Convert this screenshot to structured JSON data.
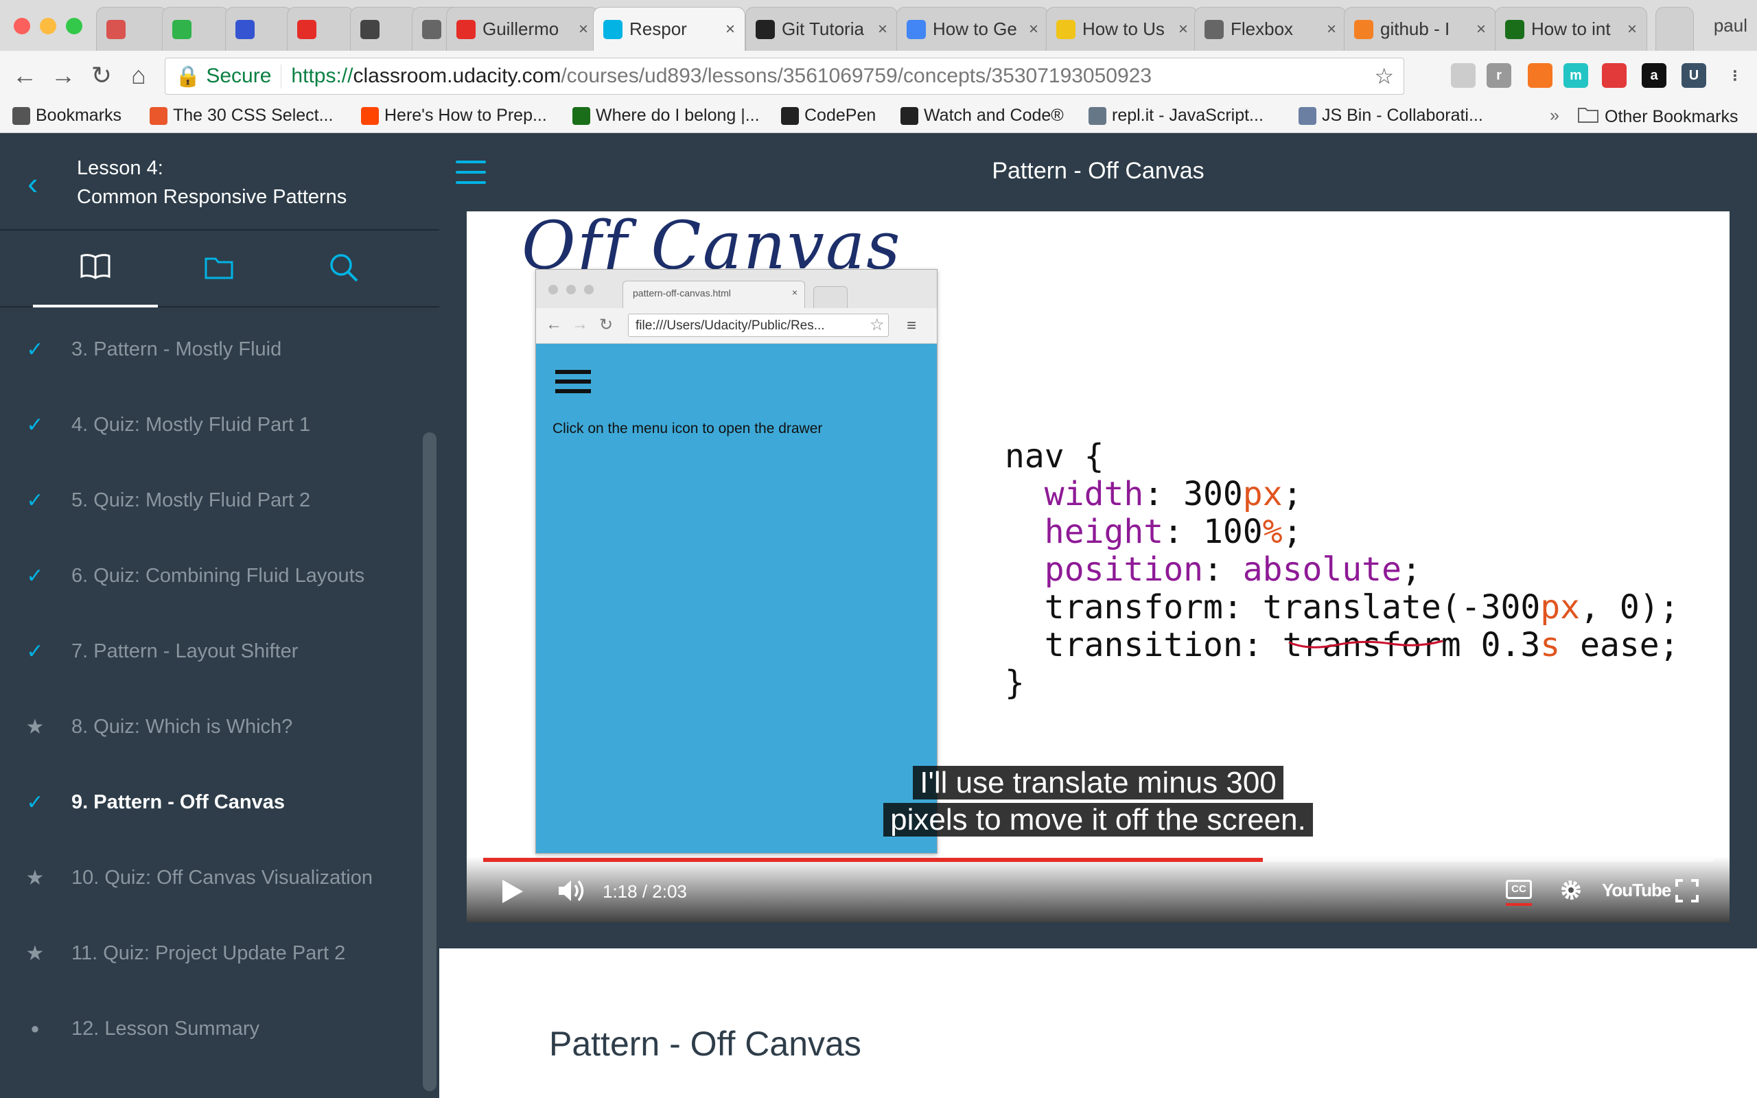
{
  "browser": {
    "tabs": [
      {
        "icon": "mushroom-icon",
        "color": "#d9534f",
        "title": ""
      },
      {
        "icon": "udacity-u-icon",
        "color": "#2fb34a",
        "title": ""
      },
      {
        "icon": "c-icon",
        "color": "#3454d1",
        "title": ""
      },
      {
        "icon": "youtube-icon",
        "color": "#e52d27",
        "title": ""
      },
      {
        "icon": "camera-icon",
        "color": "#444444",
        "title": ""
      },
      {
        "icon": "page-icon",
        "color": "#666666",
        "title": ""
      },
      {
        "icon": "youtube-icon",
        "color": "#e52d27",
        "title": "Guillermo"
      },
      {
        "icon": "udacity-icon",
        "color": "#02b3e4",
        "title": "Respor"
      },
      {
        "icon": "github-icon",
        "color": "#222222",
        "title": "Git Tutoria"
      },
      {
        "icon": "google-icon",
        "color": "#4285f4",
        "title": "How to Ge"
      },
      {
        "icon": "d-icon",
        "color": "#f0c419",
        "title": "How to Us"
      },
      {
        "icon": "page-icon",
        "color": "#666666",
        "title": "Flexbox"
      },
      {
        "icon": "stackoverflow-icon",
        "color": "#f48024",
        "title": "github - I"
      },
      {
        "icon": "codingame-icon",
        "color": "#1a6e1a",
        "title": "How to int"
      }
    ],
    "active_tab": 7,
    "profile": "paul",
    "secure_label": "Secure",
    "url_scheme": "https://",
    "url_host": "classroom.udacity.com",
    "url_path": "/courses/ud893/lessons/3561069759/concepts/35307193050923",
    "extensions": [
      {
        "icon": "cube-icon",
        "color": "#cccccc",
        "glyph": ""
      },
      {
        "icon": "r-icon",
        "color": "#999999",
        "glyph": "r"
      },
      {
        "icon": "hubspot-icon",
        "color": "#f57722",
        "glyph": ""
      },
      {
        "icon": "m-icon",
        "color": "#23c4c4",
        "glyph": "m"
      },
      {
        "icon": "tomato-icon",
        "color": "#e23a3a",
        "glyph": ""
      },
      {
        "icon": "amazon-icon",
        "color": "#111111",
        "glyph": "a"
      },
      {
        "icon": "u-icon",
        "color": "#3b5166",
        "glyph": "U"
      }
    ],
    "bookmarks": [
      {
        "label": "Bookmarks",
        "icon": "grid-icon",
        "color": "#555555"
      },
      {
        "label": "The 30 CSS Select...",
        "icon": "plus-icon",
        "color": "#e9572b"
      },
      {
        "label": "Here's How to Prep...",
        "icon": "reddit-icon",
        "color": "#ff4500"
      },
      {
        "label": "Where do I belong |...",
        "icon": "codingame-icon",
        "color": "#1a6e1a"
      },
      {
        "label": "CodePen",
        "icon": "codepen-icon",
        "color": "#222222"
      },
      {
        "label": "Watch and Code®",
        "icon": "w-icon",
        "color": "#222222"
      },
      {
        "label": "repl.it - JavaScript...",
        "icon": "replit-icon",
        "color": "#667788"
      },
      {
        "label": "JS Bin - Collaborati...",
        "icon": "jsbin-icon",
        "color": "#6b7fa3"
      }
    ],
    "overflow_label": "»",
    "other_bookmarks": "Other Bookmarks"
  },
  "sidebar": {
    "lesson_label": "Lesson 4:",
    "lesson_name": "Common Responsive Patterns",
    "concepts": [
      {
        "label": "3. Pattern - Mostly Fluid",
        "status": "done",
        "mark": "✓"
      },
      {
        "label": "4. Quiz: Mostly Fluid Part 1",
        "status": "done",
        "mark": "✓"
      },
      {
        "label": "5. Quiz: Mostly Fluid Part 2",
        "status": "done",
        "mark": "✓"
      },
      {
        "label": "6. Quiz: Combining Fluid Layouts",
        "status": "done",
        "mark": "✓"
      },
      {
        "label": "7. Pattern - Layout Shifter",
        "status": "done",
        "mark": "✓"
      },
      {
        "label": "8. Quiz: Which is Which?",
        "status": "quiz",
        "mark": "★"
      },
      {
        "label": "9. Pattern - Off Canvas",
        "status": "current",
        "mark": "✓"
      },
      {
        "label": "10. Quiz: Off Canvas Visualization",
        "status": "quiz",
        "mark": "★"
      },
      {
        "label": "11. Quiz: Project Update Part 2",
        "status": "quiz",
        "mark": "★"
      },
      {
        "label": "12. Lesson Summary",
        "status": "todo",
        "mark": "●"
      }
    ]
  },
  "header": {
    "title": "Pattern - Off Canvas"
  },
  "video": {
    "handwritten_title": "Off Canvas",
    "mock": {
      "tab_title": "pattern-off-canvas.html",
      "url": "file:///Users/Udacity/Public/Res...",
      "body_text": "Click on the menu icon to open the drawer"
    },
    "code": {
      "l1": "nav {",
      "width_prop": "width",
      "width_num": "300",
      "width_unit": "px",
      "height_prop": "height",
      "height_num": "100",
      "height_unit": "%",
      "position_prop": "position",
      "position_val": "absolute",
      "transform_a": "transform: translate(-300",
      "transform_unit": "px",
      "transform_b": ", 0);",
      "transition_a": "transition: transform 0.3",
      "transition_unit": "s",
      "transition_b": " ease;",
      "close": "}"
    },
    "caption_line1": "I'll use translate minus 300",
    "caption_line2": "pixels to move it off the screen.",
    "time": "1:18 / 2:03",
    "progress": 0.634,
    "cc_label": "CC",
    "yt_logo": "YouTube"
  },
  "page": {
    "title": "Pattern - Off Canvas"
  }
}
